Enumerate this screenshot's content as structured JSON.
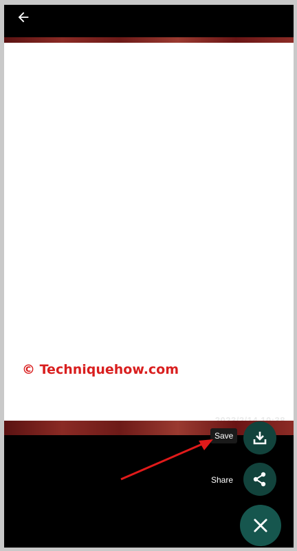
{
  "header": {
    "back_icon": "arrow-left-icon"
  },
  "watermark": {
    "text": "© Techniquehow.com",
    "color": "#d91f1f"
  },
  "photo": {
    "timestamp": "2023/2/14 10:38"
  },
  "actions": {
    "save_label": "Save",
    "save_icon": "download-icon",
    "share_label": "Share",
    "share_icon": "share-icon",
    "close_icon": "close-icon"
  },
  "annotation": {
    "arrow_color": "#e01a1a"
  },
  "colors": {
    "fab_background": "#12433c",
    "fab_close_background": "#16564e",
    "screen_background": "#000000"
  }
}
